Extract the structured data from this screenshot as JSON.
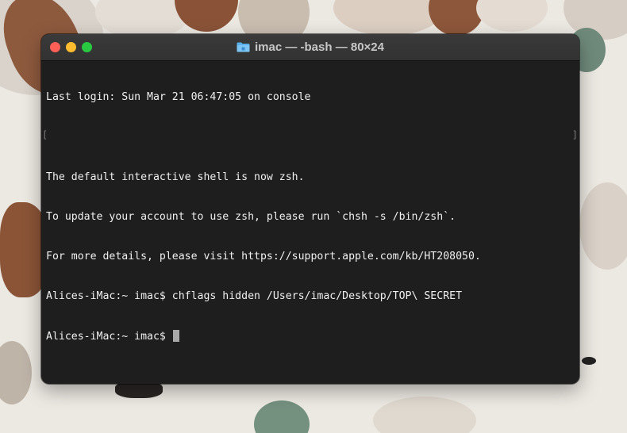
{
  "window": {
    "title": "imac — -bash — 80×24",
    "folder_icon": "folder-icon"
  },
  "terminal": {
    "lines": [
      "Last login: Sun Mar 21 06:47:05 on console",
      "",
      "The default interactive shell is now zsh.",
      "To update your account to use zsh, please run `chsh -s /bin/zsh`.",
      "For more details, please visit https://support.apple.com/kb/HT208050.",
      "Alices-iMac:~ imac$ chflags hidden /Users/imac/Desktop/TOP\\ SECRET",
      "Alices-iMac:~ imac$ "
    ],
    "bracket_left": "[",
    "bracket_right": "]"
  },
  "colors": {
    "close": "#ff5f57",
    "minimize": "#febc2e",
    "maximize": "#28c840",
    "terminal_bg": "#1e1e1e",
    "text": "#f0f0f0"
  }
}
